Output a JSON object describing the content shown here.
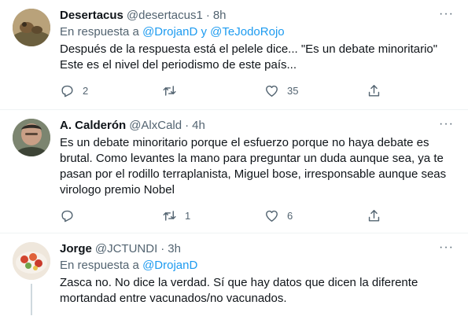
{
  "tweets": [
    {
      "name": "Desertacus",
      "handle": "@desertacus1",
      "sep": "·",
      "time": "8h",
      "reply_prefix": "En respuesta a",
      "reply_to_1": "@DrojanD",
      "reply_and": "y",
      "reply_to_2": "@TeJodoRojo",
      "text": "Después de la respuesta está el pelele dice... \"Es un debate minoritario\"\nEste es el nivel del periodismo de este país...",
      "replies": "2",
      "retweets": "",
      "likes": "35",
      "more": "···"
    },
    {
      "name": "A. Calderón",
      "handle": "@AlxCald",
      "sep": "·",
      "time": "4h",
      "text": "Es un debate minoritario porque el esfuerzo porque no haya debate es\nbrutal. Como levantes la mano para preguntar un duda aunque sea, ya te\npasan por el rodillo terraplanista, Miguel bose, irresponsable aunque seas\nvirologo premio Nobel",
      "replies": "",
      "retweets": "1",
      "likes": "6",
      "more": "···"
    },
    {
      "name": "Jorge",
      "handle": "@JCTUNDI",
      "sep": "·",
      "time": "3h",
      "reply_prefix": "En respuesta a",
      "reply_to_1": "@DrojanD",
      "text": "Zasca no. No dice la verdad. Sí que hay datos que dicen la diferente\nmortandad entre vacunados/no vacunados.",
      "more": "···"
    }
  ],
  "icons": [
    "reply-icon",
    "retweet-icon",
    "like-icon",
    "share-icon"
  ],
  "colors": {
    "link": "#1d9bf0",
    "muted": "#536471",
    "divider": "#eff3f4",
    "thread": "#cfd9de"
  }
}
